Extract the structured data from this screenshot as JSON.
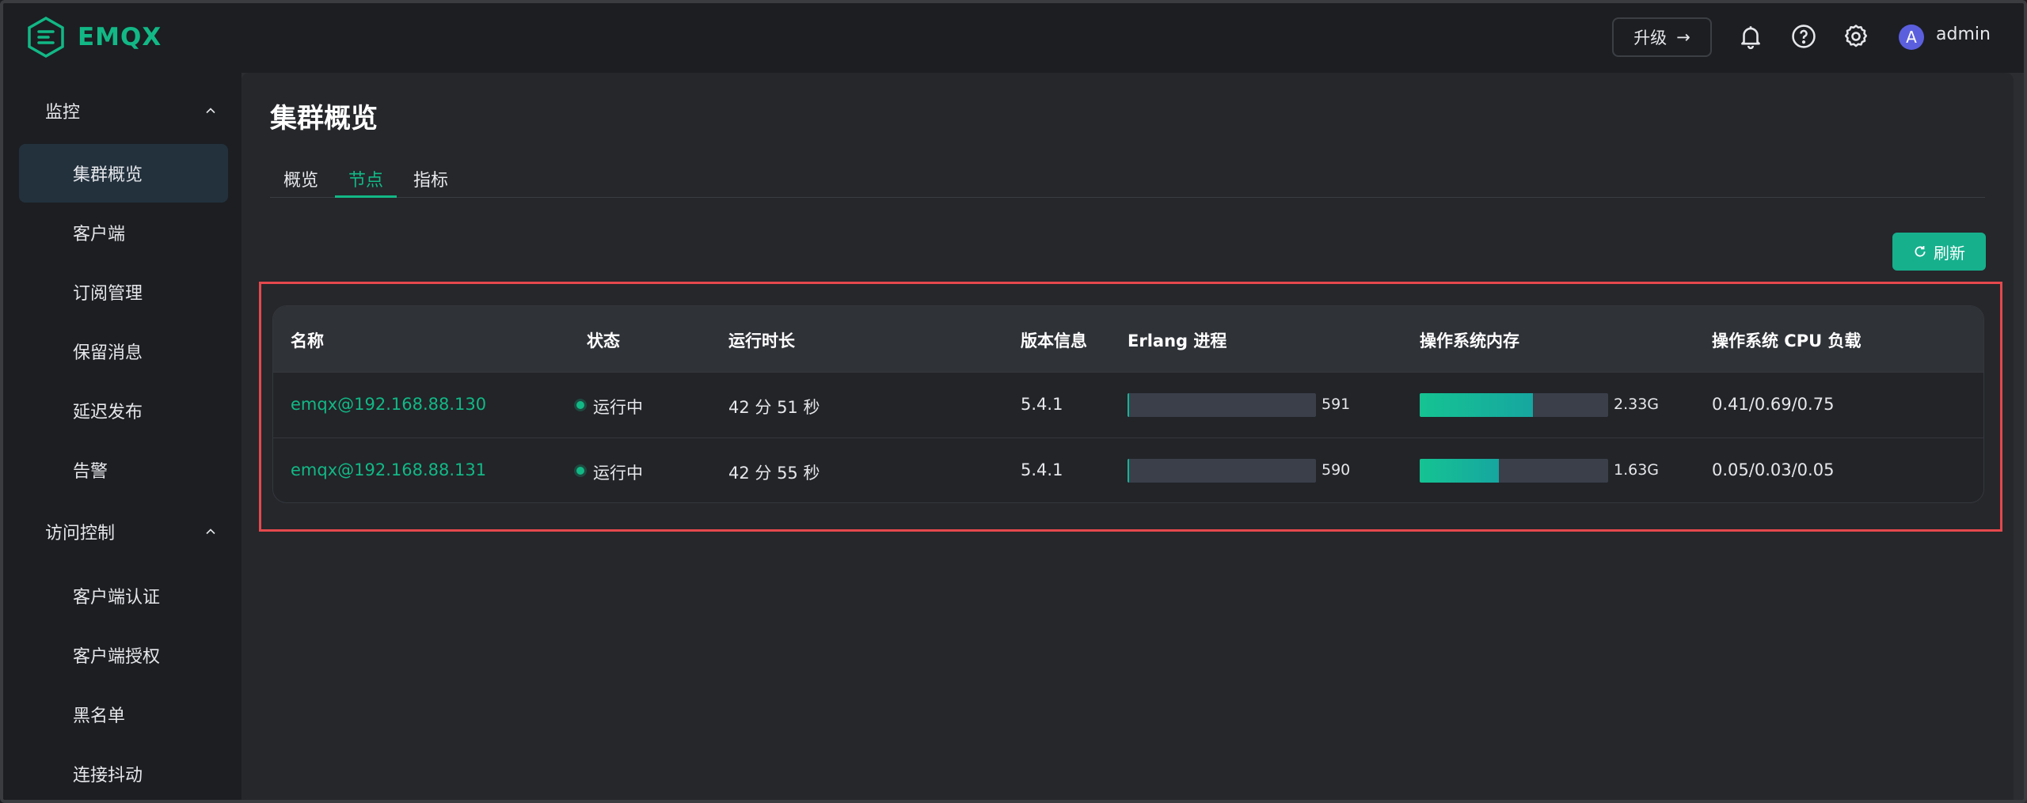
{
  "brand": {
    "name": "EMQX",
    "accent": "#12b886"
  },
  "header": {
    "upgrade_label": "升级",
    "upgrade_arrow": "→",
    "icons": [
      "bell-icon",
      "help-icon",
      "gear-icon"
    ],
    "avatar_letter": "A",
    "username": "admin"
  },
  "sidebar": {
    "groups": [
      {
        "label": "监控",
        "items": [
          "集群概览",
          "客户端",
          "订阅管理",
          "保留消息",
          "延迟发布",
          "告警"
        ]
      },
      {
        "label": "访问控制",
        "items": [
          "客户端认证",
          "客户端授权",
          "黑名单",
          "连接抖动"
        ]
      }
    ],
    "active_item": "集群概览"
  },
  "main": {
    "title": "集群概览",
    "tabs": [
      {
        "label": "概览"
      },
      {
        "label": "节点",
        "active": true
      },
      {
        "label": "指标"
      }
    ],
    "refresh_label": "刷新",
    "table": {
      "headers": [
        "名称",
        "状态",
        "运行时长",
        "版本信息",
        "Erlang 进程",
        "操作系统内存",
        "操作系统 CPU 负载"
      ],
      "rows": [
        {
          "name": "emqx@192.168.88.130",
          "status": "运行中",
          "uptime": "42 分 51 秒",
          "version": "5.4.1",
          "erlang_processes": "591",
          "erlang_fill": 0.01,
          "memory": "2.33G",
          "memory_fill": 0.6,
          "cpu_load": "0.41/0.69/0.75"
        },
        {
          "name": "emqx@192.168.88.131",
          "status": "运行中",
          "uptime": "42 分 55 秒",
          "version": "5.4.1",
          "erlang_processes": "590",
          "erlang_fill": 0.01,
          "memory": "1.63G",
          "memory_fill": 0.42,
          "cpu_load": "0.05/0.03/0.05"
        }
      ]
    }
  }
}
